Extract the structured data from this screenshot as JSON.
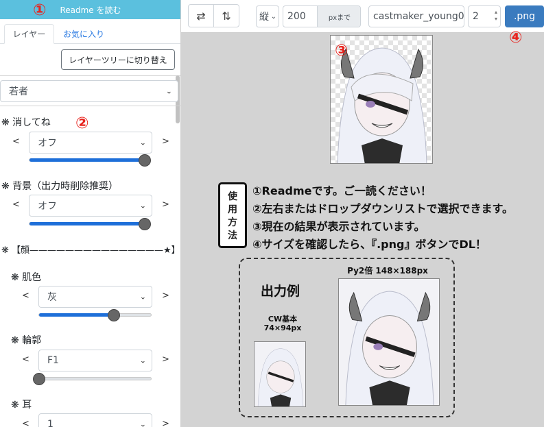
{
  "sidebar": {
    "readme_label": "Readme を読む",
    "tabs": [
      {
        "label": "レイヤー",
        "active": true
      },
      {
        "label": "お気に入り",
        "active": false
      }
    ],
    "tree_toggle_label": "レイヤーツリーに切り替え",
    "preset_value": "若者",
    "params": [
      {
        "label": "❋ 消してね",
        "value": "オフ",
        "level": 1.0
      },
      {
        "label": "❋ 背景（出力時削除推奨）",
        "value": "オフ",
        "level": 1.0
      },
      {
        "label": "❋ 【顔———————————————★】"
      },
      {
        "label": "❋ 肌色",
        "value": "灰",
        "level": 0.67
      },
      {
        "label": "❋ 輪郭",
        "value": "F1",
        "level": 0.0
      },
      {
        "label": "❋ 耳",
        "value": "1"
      }
    ],
    "prev_arrow": "<",
    "next_arrow": ">"
  },
  "topbar": {
    "swap_h_icon": "⇄",
    "swap_v_icon": "⇅",
    "orientation_value": "縦",
    "size_value": "200",
    "size_unit": "pxまで",
    "filename_value": "castmaker_young0",
    "scale_value": "2",
    "png_label": ".png"
  },
  "main": {
    "usage_title": "使用方法",
    "usage_lines": [
      "①Readmeです。ご一読ください！",
      "②左右またはドロップダウンリストで選択できます。",
      "③現在の結果が表示されています。",
      "④サイズを確認したら、『.png』ボタンでDL！"
    ],
    "example_title": "出力例",
    "cw_label": "CW基本",
    "cw_size": "74×94px",
    "py_label": "Py2倍 148×188px"
  },
  "markers": [
    "①",
    "②",
    "③",
    "④"
  ],
  "colors": {
    "accent": "#5bc0de",
    "primary": "#3a7bbf",
    "slider": "#1e6fd9",
    "marker": "#e8231d"
  }
}
